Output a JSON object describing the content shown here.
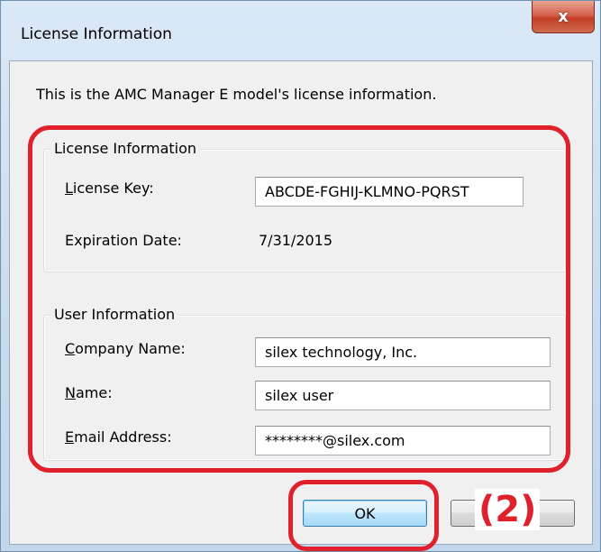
{
  "window": {
    "title": "License Information",
    "close_glyph": "x",
    "close_icon": "close-icon"
  },
  "intro_text": "This is the AMC Manager E model's license information.",
  "license_group": {
    "legend": "License Information",
    "license_key_label_accel": "L",
    "license_key_label_rest": "icense Key:",
    "license_key_value": "ABCDE-FGHIJ-KLMNO-PQRST",
    "expiration_label": "Expiration Date:",
    "expiration_value": "7/31/2015"
  },
  "user_group": {
    "legend": "User Information",
    "company_label_accel": "C",
    "company_label_rest": "ompany Name:",
    "company_value": "silex technology, Inc.",
    "name_label_accel": "N",
    "name_label_rest": "ame:",
    "name_value": "silex user",
    "email_label_accel": "E",
    "email_label_rest": "mail Address:",
    "email_value": "********@silex.com"
  },
  "buttons": {
    "ok_label": "OK"
  },
  "annotation": {
    "label": "(2)",
    "color": "#e0202a"
  }
}
